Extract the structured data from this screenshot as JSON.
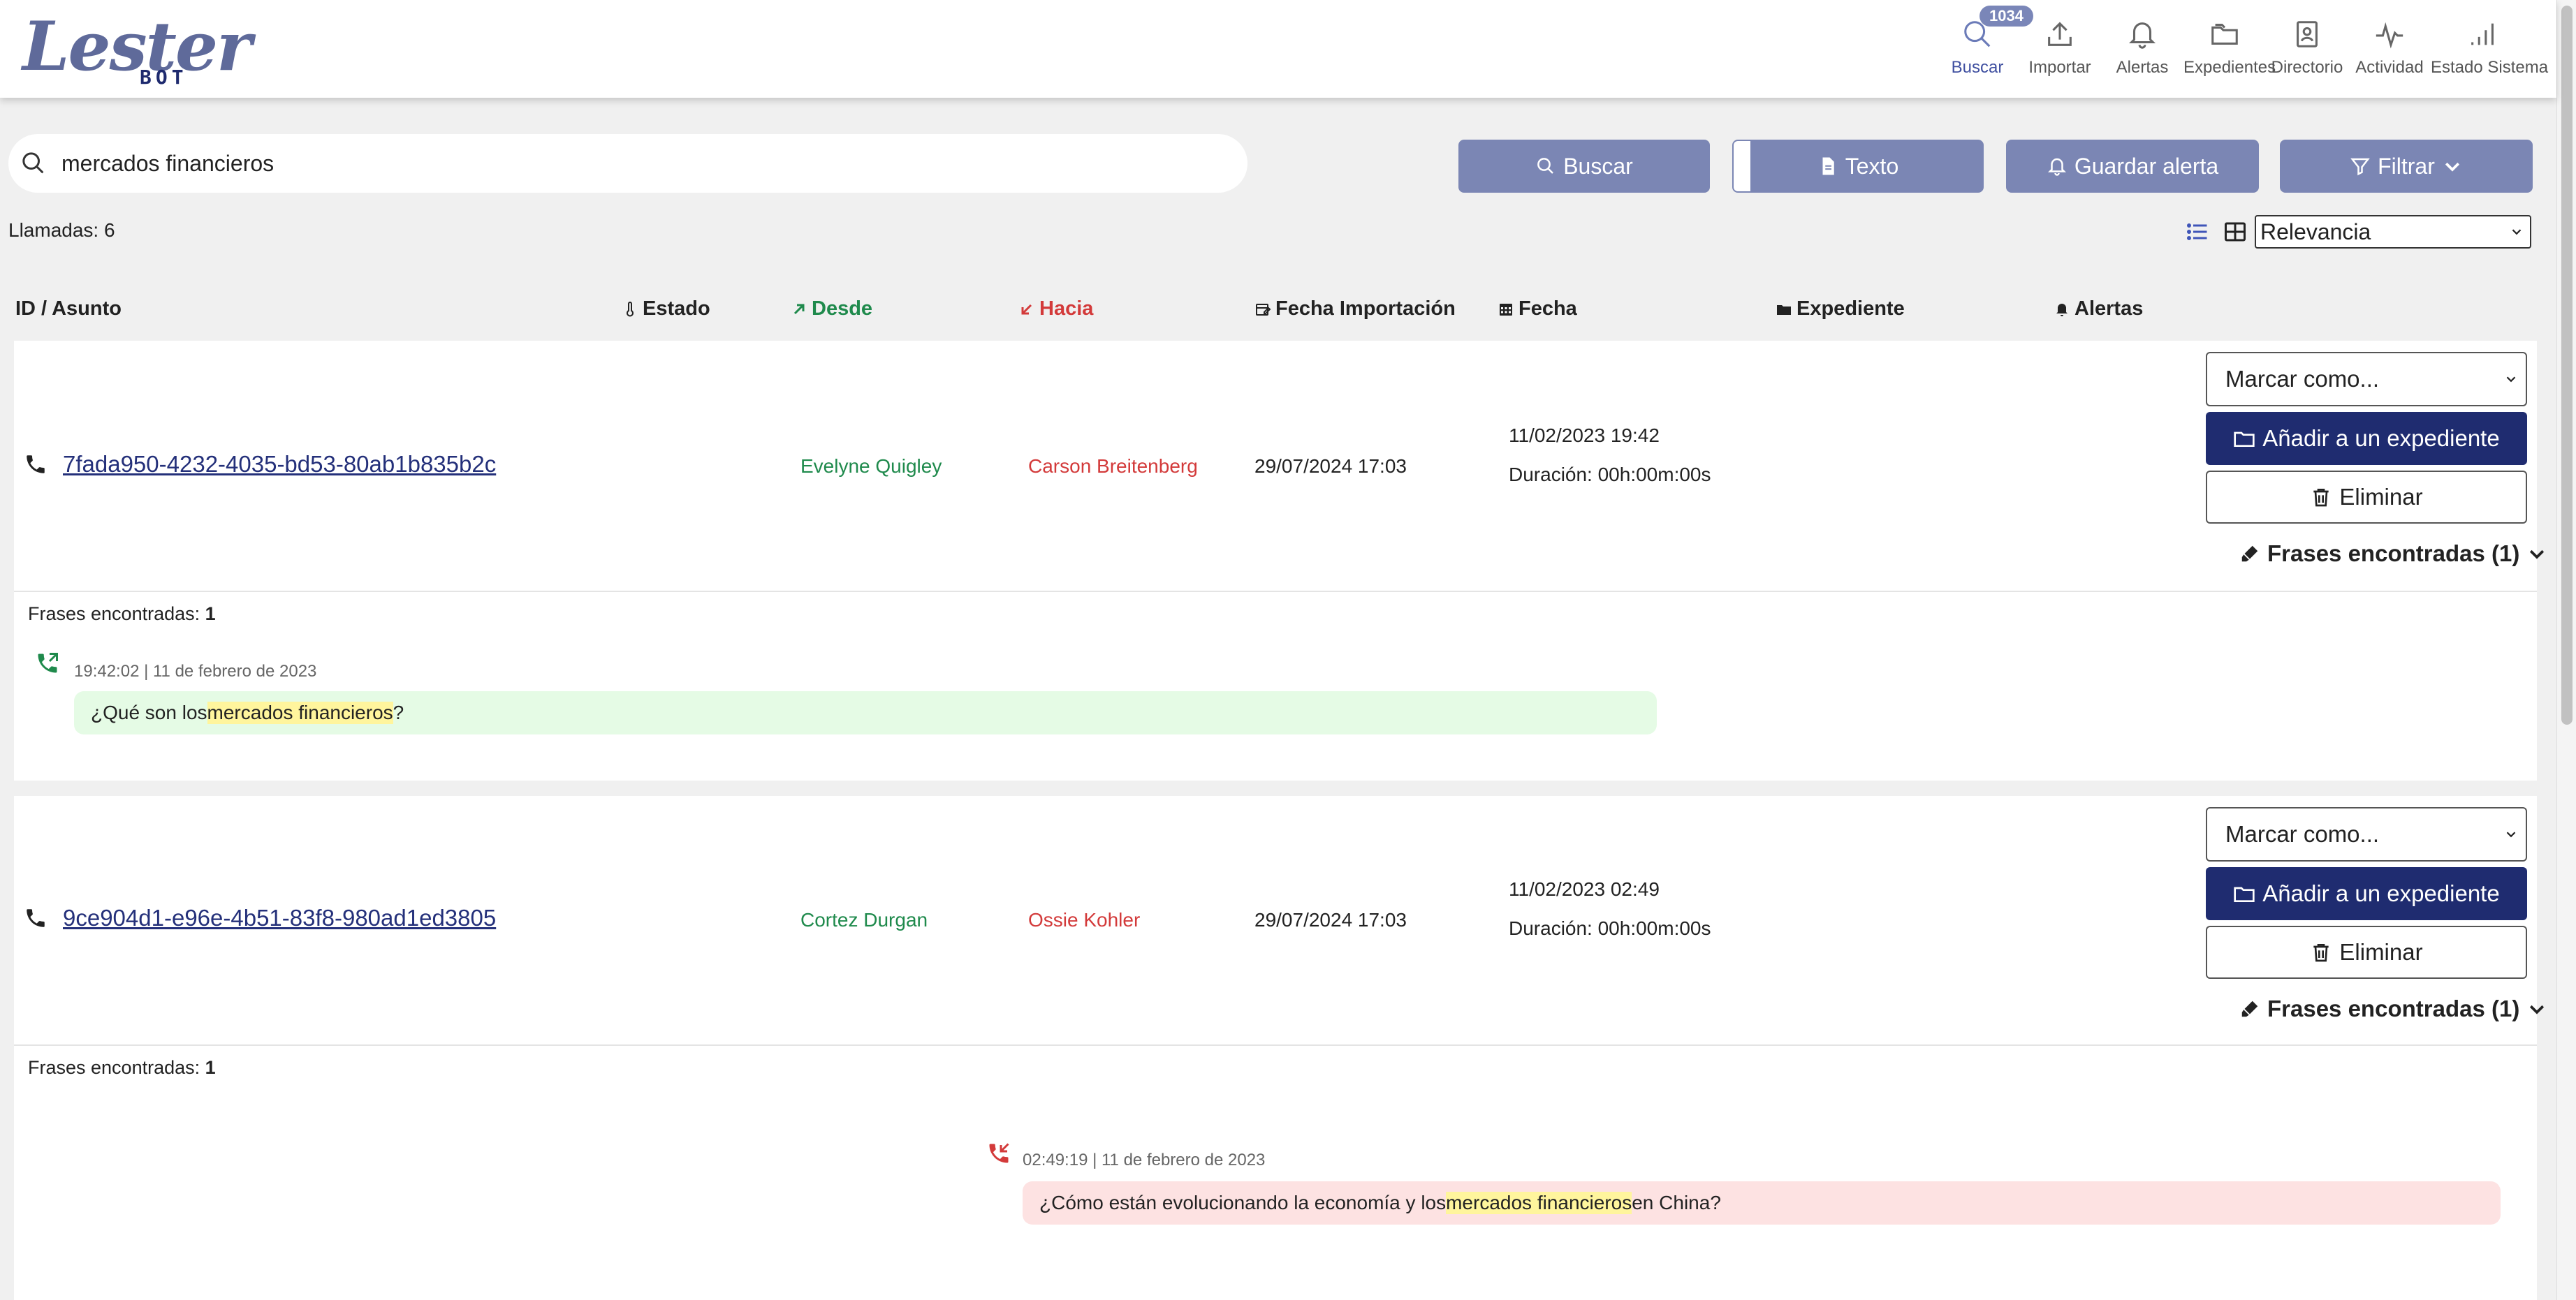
{
  "logo": {
    "word": "Lester",
    "sub": "BOT"
  },
  "nav": {
    "badge": "1034",
    "items": [
      {
        "label": "Buscar",
        "icon": "search-icon"
      },
      {
        "label": "Importar",
        "icon": "upload-icon"
      },
      {
        "label": "Alertas",
        "icon": "bell-icon"
      },
      {
        "label": "Expedientes",
        "icon": "folders-icon"
      },
      {
        "label": "Directorio",
        "icon": "contact-book-icon"
      },
      {
        "label": "Actividad",
        "icon": "activity-icon"
      },
      {
        "label": "Estado Sistema",
        "icon": "signal-bars-icon"
      }
    ]
  },
  "search": {
    "value": "mercados financieros"
  },
  "actions": {
    "buscar": "Buscar",
    "texto": "Texto",
    "guardar": "Guardar alerta",
    "filtrar": "Filtrar"
  },
  "results": {
    "count": "Llamadas: 6",
    "sort": "Relevancia"
  },
  "columns": {
    "id": "ID / Asunto",
    "estado": "Estado",
    "desde": "Desde",
    "hacia": "Hacia",
    "importacion": "Fecha Importación",
    "fecha": "Fecha",
    "expediente": "Expediente",
    "alertas": "Alertas"
  },
  "row_actions": {
    "marcar": "Marcar como...",
    "anadir": "Añadir a un expediente",
    "eliminar": "Eliminar",
    "frases_toggle": "Frases encontradas (1)"
  },
  "rows": [
    {
      "id": "7fada950-4232-4035-bd53-80ab1b835b2c",
      "from": "Evelyne Quigley",
      "to": "Carson Breitenberg",
      "imported": "29/07/2024 17:03",
      "date": "11/02/2023 19:42",
      "duration": "Duración: 00h:00m:00s",
      "detail_label": "Frases encontradas: ",
      "detail_count": "1",
      "phrase_meta": "19:42:02 | 11 de febrero de 2023",
      "phrase_pre": "¿Qué son los ",
      "phrase_hl": "mercados financieros",
      "phrase_post": "?"
    },
    {
      "id": "9ce904d1-e96e-4b51-83f8-980ad1ed3805",
      "from": "Cortez Durgan",
      "to": "Ossie Kohler",
      "imported": "29/07/2024 17:03",
      "date": "11/02/2023 02:49",
      "duration": "Duración: 00h:00m:00s",
      "detail_label": "Frases encontradas: ",
      "detail_count": "1",
      "phrase_meta": "02:49:19 | 11 de febrero de 2023",
      "phrase_pre": "¿Cómo están evolucionando la economía y los ",
      "phrase_hl": "mercados financieros",
      "phrase_post": " en China?"
    }
  ]
}
